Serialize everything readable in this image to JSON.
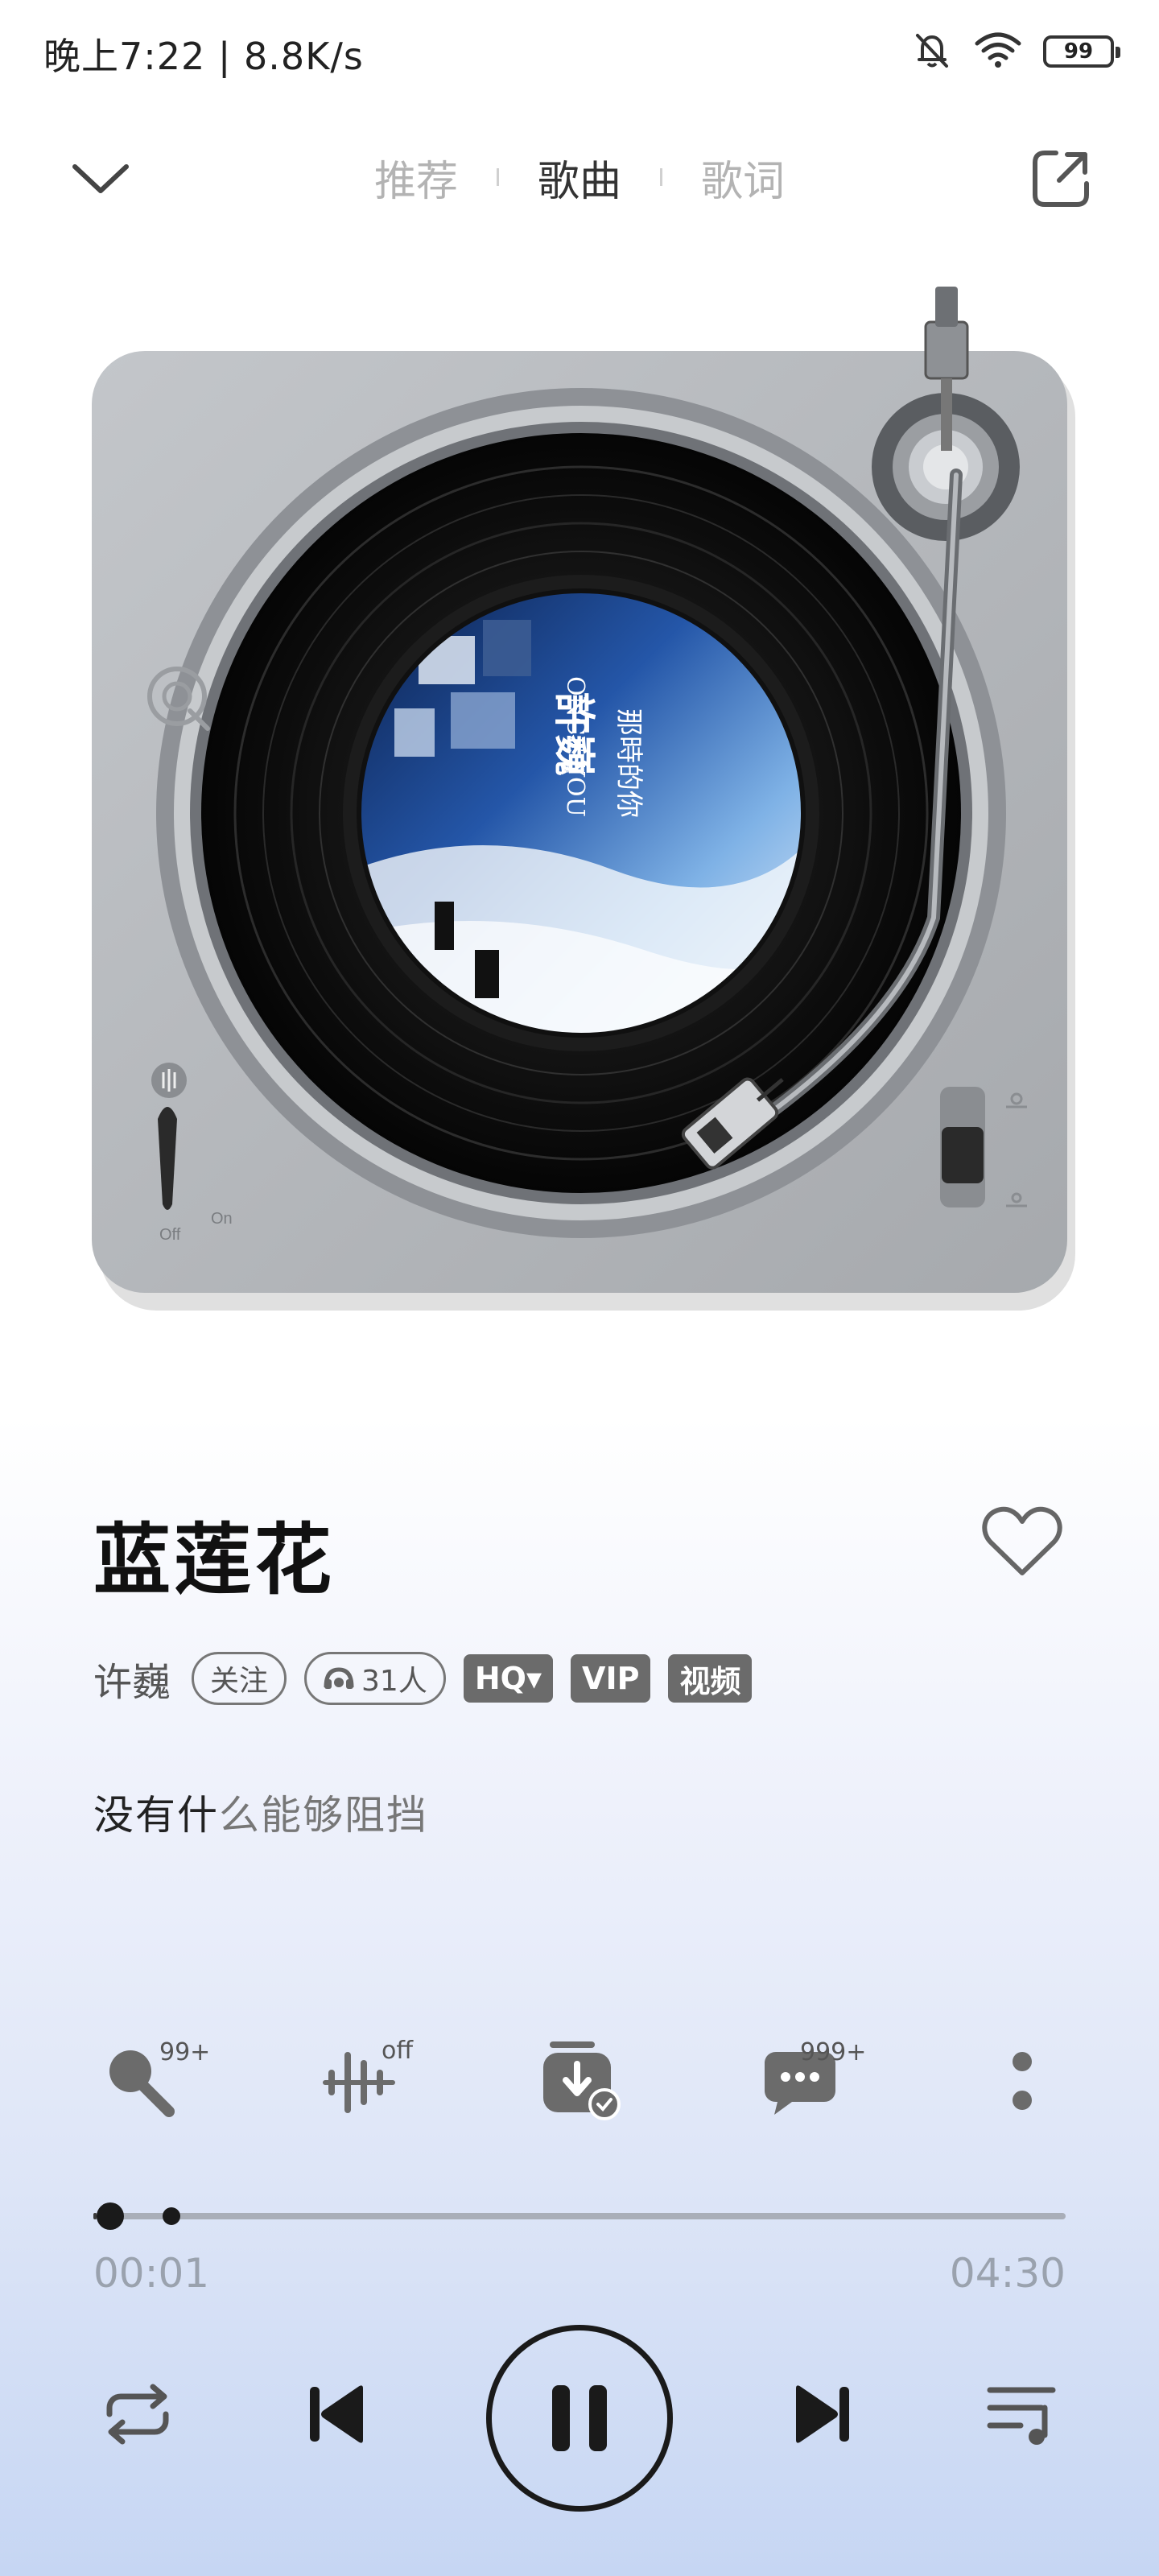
{
  "status_bar": {
    "time": "晚上7:22 | 8.8K/s",
    "battery": "99"
  },
  "header": {
    "tabs": [
      {
        "label": "推荐",
        "active": false
      },
      {
        "label": "歌曲",
        "active": true
      },
      {
        "label": "歌词",
        "active": false
      }
    ]
  },
  "turntable": {
    "switch_off_label": "Off",
    "switch_on_label": "On",
    "album_art_text": {
      "artist": "許巍",
      "subtitle": "ONCE YOU",
      "album": "那時的你"
    }
  },
  "song": {
    "title": "蓝莲花",
    "artist": "许巍",
    "follow_label": "关注",
    "listeners_label": "31人",
    "quality_tag": "HQ▾",
    "vip_tag": "VIP",
    "video_tag": "视频",
    "lyric_highlight": "没有什",
    "lyric_rest": "么能够阻挡"
  },
  "actions": {
    "karaoke_badge": "99+",
    "effects_badge": "off",
    "comments_badge": "999+"
  },
  "progress": {
    "elapsed": "00:01",
    "duration": "04:30",
    "played_fraction": 0.0037,
    "buffered_fraction": 0.08
  },
  "colors": {
    "accent_dark": "#1a1a1a",
    "tag_bg": "#6b6b6b",
    "turntable_body": "#b4b7bb"
  }
}
